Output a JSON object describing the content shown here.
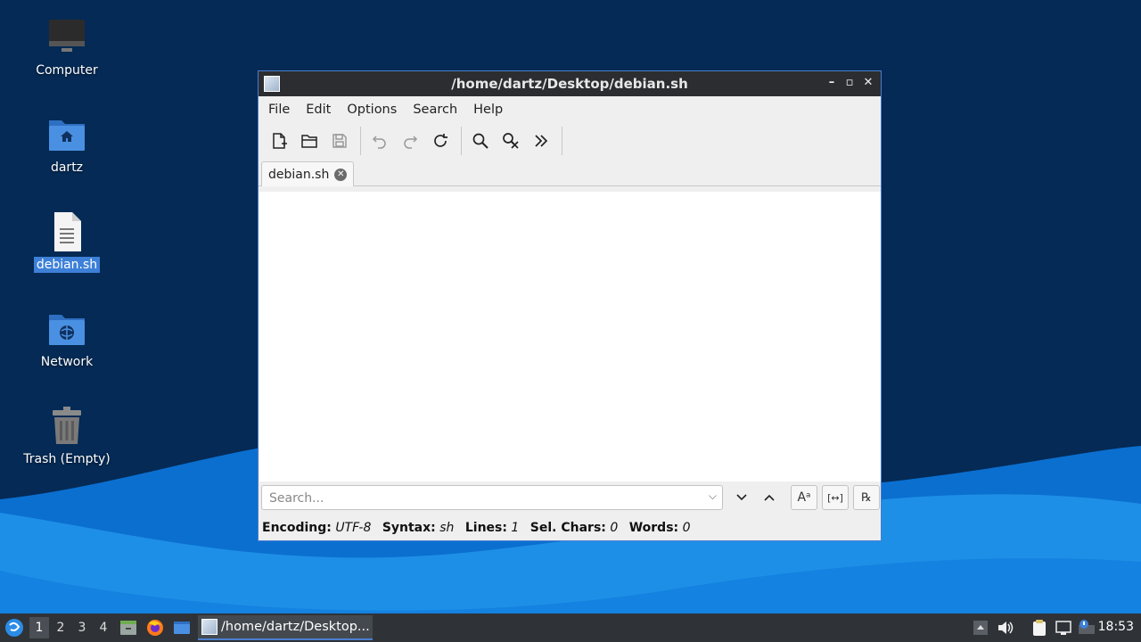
{
  "desktop": {
    "icons": [
      {
        "label": "Computer"
      },
      {
        "label": "dartz"
      },
      {
        "label": "debian.sh"
      },
      {
        "label": "Network"
      },
      {
        "label": "Trash (Empty)"
      }
    ]
  },
  "window": {
    "title": "/home/dartz/Desktop/debian.sh",
    "controls": {
      "minimize": "–",
      "maximize": "▫",
      "close": "✕"
    },
    "menu": [
      "File",
      "Edit",
      "Options",
      "Search",
      "Help"
    ],
    "toolbar": [
      "new-document",
      "open",
      "save",
      "undo",
      "redo",
      "reload",
      "find",
      "replace",
      "more"
    ],
    "tab": {
      "label": "debian.sh",
      "close": "✕"
    },
    "search": {
      "placeholder": "Search..."
    },
    "status": {
      "encoding_label": "Encoding:",
      "encoding": "UTF-8",
      "syntax_label": "Syntax:",
      "syntax": "sh",
      "lines_label": "Lines:",
      "lines": "1",
      "selchars_label": "Sel. Chars:",
      "selchars": "0",
      "words_label": "Words:",
      "words": "0"
    }
  },
  "taskbar": {
    "workspaces": [
      "1",
      "2",
      "3",
      "4"
    ],
    "active_workspace": "1",
    "task_title": "/home/dartz/Desktop...",
    "clock": "18:53"
  },
  "colors": {
    "accent": "#4c7ed0",
    "desktop_bg": "#042a55",
    "wave": "#1e8fe6"
  }
}
